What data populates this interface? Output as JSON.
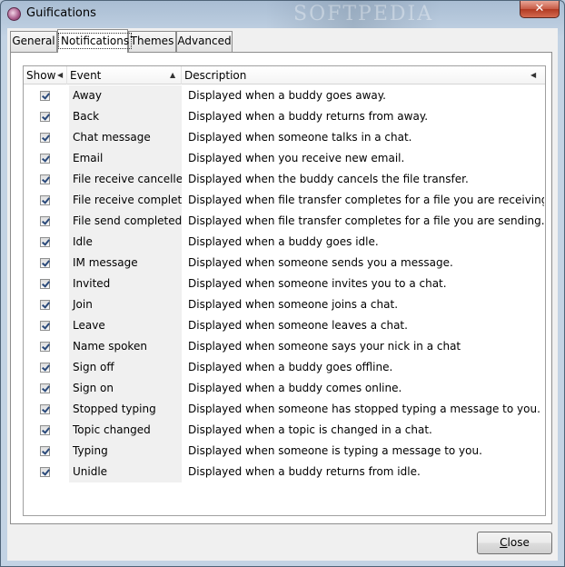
{
  "window": {
    "title": "Guifications",
    "watermark": "SOFTPEDIA",
    "close_glyph": "✕"
  },
  "tabs": [
    {
      "label": "General",
      "active": false
    },
    {
      "label": "Notifications",
      "active": true
    },
    {
      "label": "Themes",
      "active": false
    },
    {
      "label": "Advanced",
      "active": false
    }
  ],
  "table": {
    "columns": {
      "show": "Show",
      "event": "Event",
      "description": "Description"
    },
    "rows": [
      {
        "show": true,
        "event": "Away",
        "description": "Displayed when a buddy goes away."
      },
      {
        "show": true,
        "event": "Back",
        "description": "Displayed when a buddy returns from away."
      },
      {
        "show": true,
        "event": "Chat message",
        "description": "Displayed when someone talks in a chat."
      },
      {
        "show": true,
        "event": "Email",
        "description": "Displayed when you receive new email."
      },
      {
        "show": true,
        "event": "File receive cancelled",
        "description": "Displayed when the buddy cancels the file transfer."
      },
      {
        "show": true,
        "event": "File receive completed",
        "description": "Displayed when file transfer completes for a file you are receiving."
      },
      {
        "show": true,
        "event": "File send completed",
        "description": "Displayed when file transfer completes for a file you are sending."
      },
      {
        "show": true,
        "event": "Idle",
        "description": "Displayed when a buddy goes idle."
      },
      {
        "show": true,
        "event": "IM message",
        "description": "Displayed when someone sends you a message."
      },
      {
        "show": true,
        "event": "Invited",
        "description": "Displayed when someone invites you to a chat."
      },
      {
        "show": true,
        "event": "Join",
        "description": "Displayed when someone joins a chat."
      },
      {
        "show": true,
        "event": "Leave",
        "description": "Displayed when someone leaves a chat."
      },
      {
        "show": true,
        "event": "Name spoken",
        "description": "Displayed when someone says your nick in a chat"
      },
      {
        "show": true,
        "event": "Sign off",
        "description": "Displayed when a buddy goes offline."
      },
      {
        "show": true,
        "event": "Sign on",
        "description": "Displayed when a buddy comes online."
      },
      {
        "show": true,
        "event": "Stopped typing",
        "description": "Displayed when someone has stopped typing a message to you."
      },
      {
        "show": true,
        "event": "Topic changed",
        "description": "Displayed when a topic is changed in a chat."
      },
      {
        "show": true,
        "event": "Typing",
        "description": "Displayed when someone is typing a message to you."
      },
      {
        "show": true,
        "event": "Unidle",
        "description": "Displayed when a buddy returns from idle."
      }
    ]
  },
  "buttons": {
    "close_label_mnemonic": "C",
    "close_label_rest": "lose"
  }
}
